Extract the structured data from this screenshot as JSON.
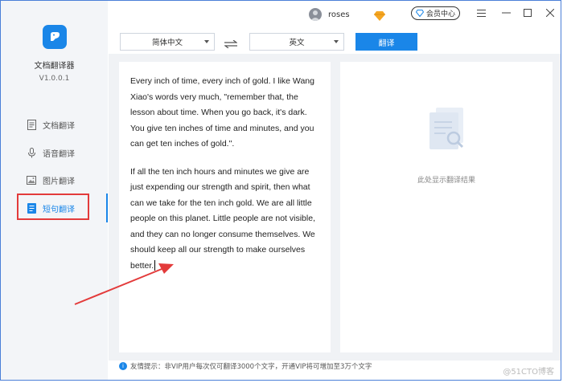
{
  "app": {
    "name": "文档翻译器",
    "version": "V1.0.0.1"
  },
  "user": {
    "name": "roses"
  },
  "vip_button": "会员中心",
  "nav": [
    {
      "label": "文档翻译",
      "icon": "document-icon"
    },
    {
      "label": "语音翻译",
      "icon": "microphone-icon"
    },
    {
      "label": "图片翻译",
      "icon": "image-icon"
    },
    {
      "label": "短句翻译",
      "icon": "sentence-icon",
      "active": true
    }
  ],
  "source_lang": "简体中文",
  "target_lang": "英文",
  "translate_button": "翻译",
  "input": {
    "paragraphs": [
      "Every inch of time, every inch of gold. I like Wang Xiao's words very much, \"remember that, the lesson about time. When you go back, it's dark. You give ten inches of time and minutes, and you can get ten inches of gold.\".",
      "If all the ten inch hours and minutes we give are just expending our strength and spirit, then what can we take for the ten inch gold. We are all little people on this planet. Little people are not visible, and they can no longer consume themselves. We should keep all our strength to make ourselves better."
    ]
  },
  "output_placeholder": "此处显示翻译结果",
  "footer_tip": "友情提示：非VIP用户每次仅可翻译3000个文字，开通VIP将可增加至3万个文字",
  "watermark": "@51CTO博客",
  "colors": {
    "accent": "#1a86e8",
    "annotation": "#e33b3b"
  }
}
